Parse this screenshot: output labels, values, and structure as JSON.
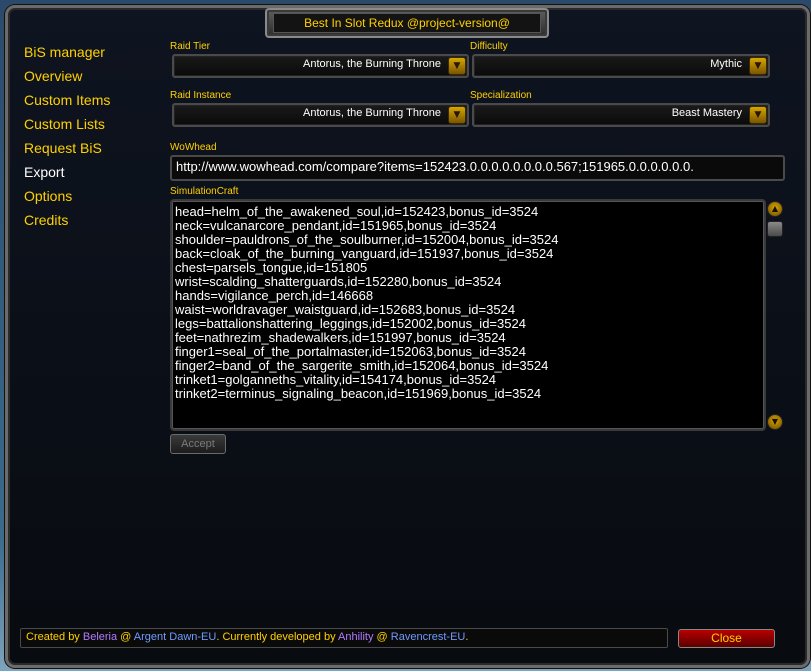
{
  "window": {
    "title": "Best In Slot Redux @project-version@"
  },
  "nav": {
    "items": [
      {
        "label": "BiS manager"
      },
      {
        "label": "Overview"
      },
      {
        "label": "Custom Items"
      },
      {
        "label": "Custom Lists"
      },
      {
        "label": "Request BiS"
      },
      {
        "label": "Export"
      },
      {
        "label": "Options"
      },
      {
        "label": "Credits"
      }
    ],
    "active": "Export"
  },
  "fields": {
    "raid_tier": {
      "label": "Raid Tier",
      "value": "Antorus, the Burning Throne"
    },
    "difficulty": {
      "label": "Difficulty",
      "value": "Mythic"
    },
    "raid_instance": {
      "label": "Raid Instance",
      "value": "Antorus, the Burning Throne"
    },
    "specialization": {
      "label": "Specialization",
      "value": "Beast Mastery"
    }
  },
  "wowhead": {
    "label": "WoWhead",
    "value": "http://www.wowhead.com/compare?items=152423.0.0.0.0.0.0.0.0.567;151965.0.0.0.0.0.0."
  },
  "simc": {
    "label": "SimulationCraft",
    "lines": [
      "head=helm_of_the_awakened_soul,id=152423,bonus_id=3524",
      "neck=vulcanarcore_pendant,id=151965,bonus_id=3524",
      "shoulder=pauldrons_of_the_soulburner,id=152004,bonus_id=3524",
      "back=cloak_of_the_burning_vanguard,id=151937,bonus_id=3524",
      "chest=parsels_tongue,id=151805",
      "wrist=scalding_shatterguards,id=152280,bonus_id=3524",
      "hands=vigilance_perch,id=146668",
      "waist=worldravager_waistguard,id=152683,bonus_id=3524",
      "legs=battalionshattering_leggings,id=152002,bonus_id=3524",
      "feet=nathrezim_shadewalkers,id=151997,bonus_id=3524",
      "finger1=seal_of_the_portalmaster,id=152063,bonus_id=3524",
      "finger2=band_of_the_sargerite_smith,id=152064,bonus_id=3524",
      "trinket1=golganneths_vitality,id=154174,bonus_id=3524",
      "trinket2=terminus_signaling_beacon,id=151969,bonus_id=3524"
    ]
  },
  "buttons": {
    "accept": "Accept",
    "close": "Close"
  },
  "status": {
    "created_by": "Created by ",
    "author": "Beleria",
    "at1": " @ ",
    "realm1": "Argent Dawn-EU",
    "developed_by": ". Currently developed by ",
    "developer": "Anhility",
    "at2": " @ ",
    "realm2": "Ravencrest-EU",
    "end": "."
  },
  "icons": {
    "dropdown_arrow": "chevron-down-icon",
    "scroll_up": "scroll-up-icon",
    "scroll_down": "scroll-down-icon"
  },
  "colors": {
    "gold": "#ffd100",
    "white": "#ffffff",
    "author": "#b07cff",
    "realm": "#6f9bff",
    "close_bg": "#a00000"
  }
}
